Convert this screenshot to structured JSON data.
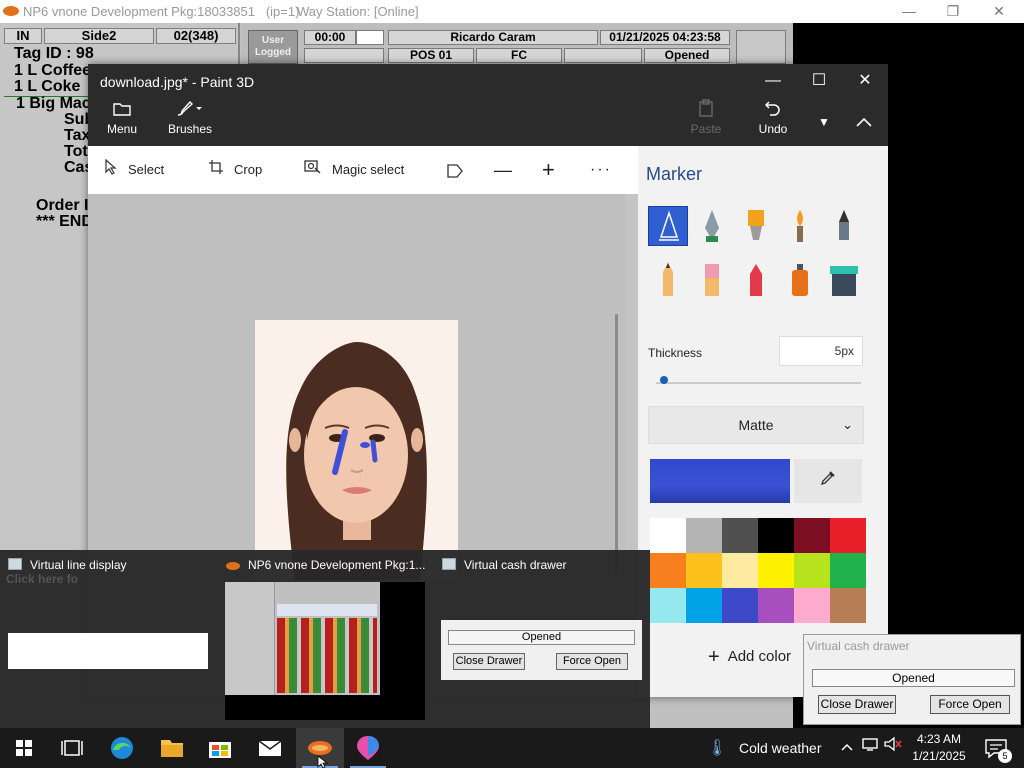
{
  "pos": {
    "title": "NP6 vnone Development Pkg:18033851   (ip=1)",
    "status": "Way Station: [Online]",
    "receipt": {
      "headers": [
        "IN",
        "Side2",
        "02(348)"
      ],
      "lines": [
        "Tag ID : 98",
        "1 L Coffee",
        "1 L Coke",
        "1 Big Mac",
        "Sub",
        "Tax",
        "Tot",
        "Cas",
        "Order I",
        "*** END"
      ]
    },
    "user_logged_label": "User Logged",
    "timer": "00:00",
    "operator": "Ricardo Caram",
    "datetime": "01/21/2025 04:23:58",
    "pos_id": "POS 01",
    "fc_label": "FC",
    "drawer_state": "Opened"
  },
  "paint": {
    "title": "download.jpg* - Paint 3D",
    "toolbar": {
      "menu": "Menu",
      "brushes": "Brushes",
      "paste": "Paste",
      "undo": "Undo"
    },
    "subbar": {
      "select": "Select",
      "crop": "Crop",
      "magic_select": "Magic select"
    },
    "sidebar": {
      "title": "Marker",
      "thickness_label": "Thickness",
      "thickness_value": "5px",
      "thickness_level": 0.02,
      "finish": "Matte",
      "current_color": "#3248cc",
      "add_color": "Add color",
      "swatches": [
        "#ffffff",
        "#b4b4b4",
        "#505050",
        "#000000",
        "#7d0f22",
        "#e8202a",
        "#f77f1e",
        "#fdc11b",
        "#feeba0",
        "#fef200",
        "#b6e31e",
        "#21b24b",
        "#95e9ee",
        "#00a3e8",
        "#3d49c9",
        "#a74fbe",
        "#fcabce",
        "#b77e56"
      ]
    }
  },
  "previews": {
    "line_display": "Virtual line display",
    "line_display_text": "Click here fo",
    "pos_app": "NP6 vnone Development Pkg:1...",
    "cash_drawer": "Virtual cash drawer",
    "cash_status": "Opened",
    "close_drawer": "Close Drawer",
    "force_open": "Force Open"
  },
  "cash_popup": {
    "title": "Virtual cash drawer",
    "status": "Opened",
    "close_drawer": "Close Drawer",
    "force_open": "Force Open"
  },
  "taskbar": {
    "weather": "Cold weather",
    "time": "4:23 AM",
    "date": "1/21/2025",
    "notifications": "5"
  }
}
